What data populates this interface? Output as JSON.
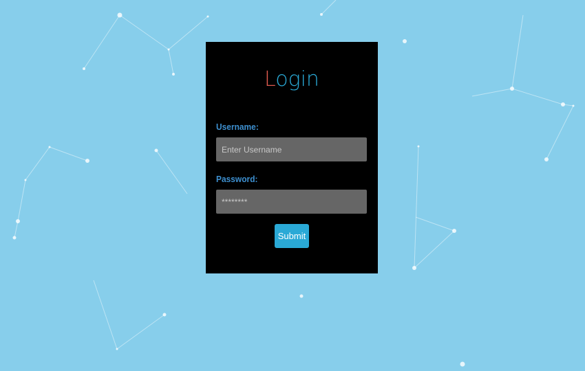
{
  "login": {
    "title_first": "L",
    "title_rest": "ogin",
    "username_label": "Username:",
    "username_placeholder": "Enter Username",
    "password_label": "Password:",
    "password_placeholder": "********",
    "submit_label": "Submit"
  },
  "colors": {
    "background": "#87ceeb",
    "panel": "#000000",
    "accent": "#2aa9d6",
    "title_first_letter": "#e05a4f",
    "label": "#3d8fcf",
    "input_bg": "#666666"
  }
}
